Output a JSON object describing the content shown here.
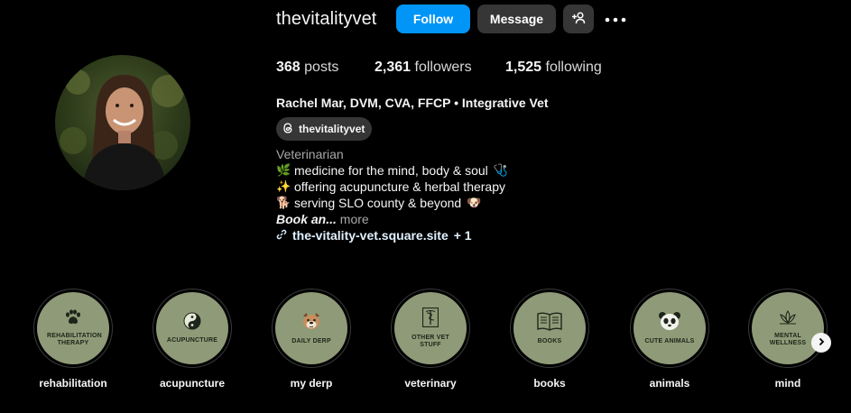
{
  "header": {
    "username": "thevitalityvet",
    "follow_label": "Follow",
    "message_label": "Message",
    "add_user_icon": "add-user-icon",
    "more_icon": "more-horizontal-icon"
  },
  "stats": {
    "posts_count": "368",
    "posts_label": "posts",
    "followers_count": "2,361",
    "followers_label": "followers",
    "following_count": "1,525",
    "following_label": "following"
  },
  "bio": {
    "full_name": "Rachel Mar, DVM, CVA, FFCP • Integrative Vet",
    "threads_handle": "thevitalityvet",
    "category": "Veterinarian",
    "lines": [
      {
        "emoji": "🌿",
        "text": "medicine for the mind, body & soul",
        "trail": "🩺"
      },
      {
        "emoji": "✨",
        "text": "offering acupuncture & herbal therapy",
        "trail": ""
      },
      {
        "emoji": "🐕",
        "text": "serving SLO county & beyond",
        "trail": "🐶"
      }
    ],
    "book_text": "Book an...",
    "more_label": "more",
    "link_text": "the-vitality-vet.square.site",
    "link_extra": "+ 1"
  },
  "highlights": [
    {
      "name": "rehabilitation",
      "cover_text": "REHABILITATION THERAPY",
      "icon": "paw-icon"
    },
    {
      "name": "acupuncture",
      "cover_text": "ACUPUNCTURE",
      "icon": "yin-yang-icon"
    },
    {
      "name": "my derp",
      "cover_text": "DAILY DERP",
      "icon": "bulldog-icon"
    },
    {
      "name": "veterinary",
      "cover_text": "OTHER VET STUFF",
      "icon": "caduceus-icon"
    },
    {
      "name": "books",
      "cover_text": "BOOKS",
      "icon": "book-icon"
    },
    {
      "name": "animals",
      "cover_text": "CUTE ANIMALS",
      "icon": "panda-icon"
    },
    {
      "name": "mind",
      "cover_text": "MENTAL WELLNESS",
      "icon": "lotus-icon"
    }
  ],
  "colors": {
    "follow_button": "#0095f6",
    "secondary_button": "#363636",
    "highlight_cover": "#8f9b78",
    "link": "#e0f1ff"
  }
}
